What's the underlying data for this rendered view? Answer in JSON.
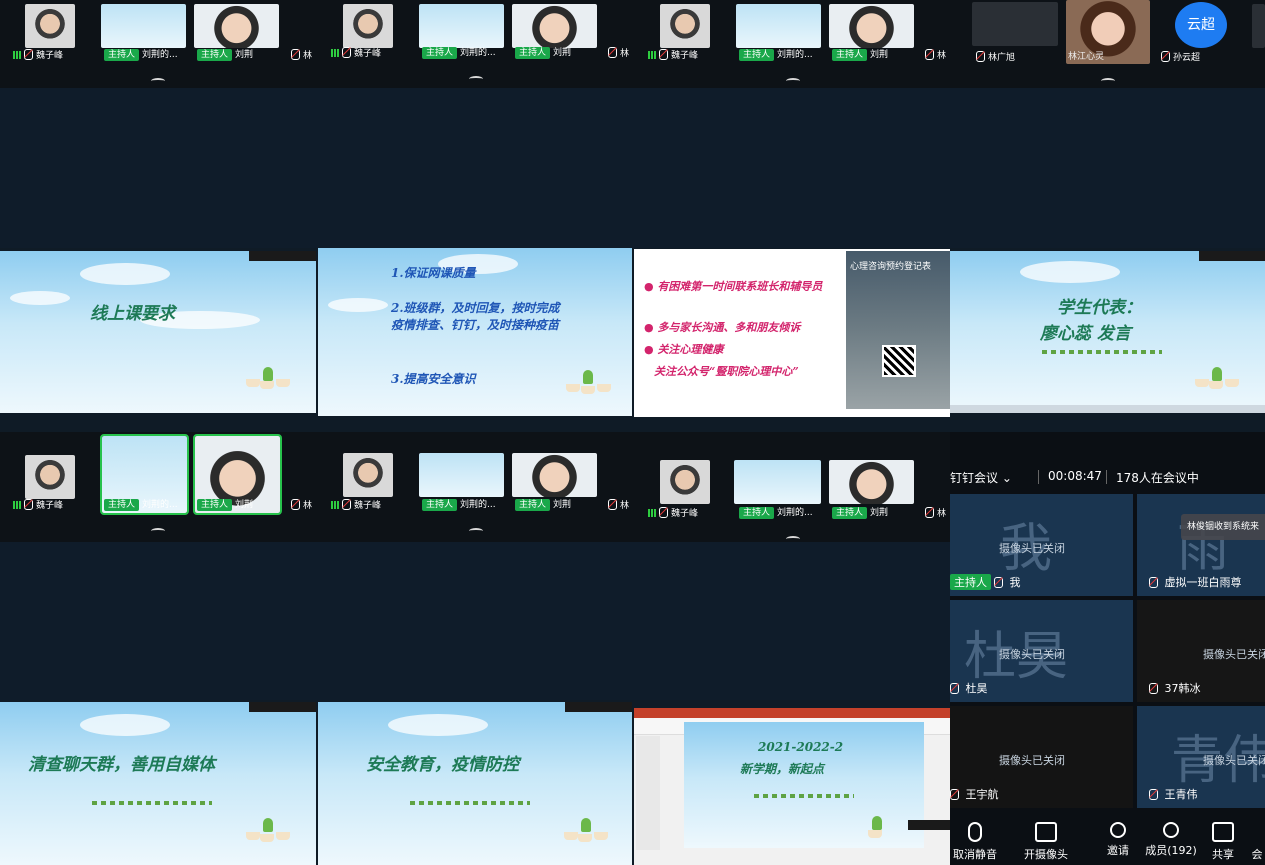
{
  "participants": {
    "weizifeng": "魏子峰",
    "host_badge": "主持人",
    "liuze_short": "刘荆的...",
    "liuze": "刘荆",
    "lin": "林",
    "lin_guangxu": "林广旭",
    "xin_ling": "林江心灵",
    "sun_yunchao": "孙云超",
    "avatar_text": "云超"
  },
  "slides": {
    "online_title": "线上课要求",
    "req_1": "1.保证网课质量",
    "req_2": "2.班级群，及时回复，按时完成疫情排查、钉钉，及时接种疫苗",
    "req_3": "3.提高安全意识",
    "psy_1": "有困难第一时间联系班长和辅导员",
    "psy_2": "多与家长沟通、多和朋友倾诉",
    "psy_3": "关注心理健康",
    "psy_4": "关注公众号“豎职院心理中心”",
    "psy_card_title": "心理咨询预约登记表",
    "rep_title_1": "学生代表：",
    "rep_title_2": "廖心蕊 发言",
    "chat_title": "清查聊天群，善用自媒体",
    "safety_title": "安全教育，疫情防控",
    "term_line1": "2021-2022-2",
    "term_line2": "新学期，新起点"
  },
  "meeting": {
    "app_name": "钉钉会议",
    "timer": "00:08:47",
    "in_meeting": "178人在会议中",
    "notice": "林俊铟收到系统来",
    "camera_off": "摄像头已关闭",
    "tiles": [
      {
        "big": "我",
        "name": "我",
        "host": true
      },
      {
        "big": "雨",
        "name": "虚拟一班白雨尊",
        "host": false
      },
      {
        "big": "杜昊",
        "name": "杜昊",
        "host": false
      },
      {
        "big": "",
        "name": "37韩冰",
        "host": false
      },
      {
        "big": "",
        "name": "王宇航",
        "host": false
      },
      {
        "big": "青伟",
        "name": "王青伟",
        "host": false
      }
    ],
    "toolbar": {
      "unmute": "取消静音",
      "camera": "开摄像头",
      "invite": "邀请",
      "members": "成员(192)",
      "share": "共享",
      "more": "会"
    }
  },
  "colors": {
    "host_green": "#1aa84a",
    "avatar_blue": "#1e7cf2",
    "slide_green": "#1d7a56"
  }
}
